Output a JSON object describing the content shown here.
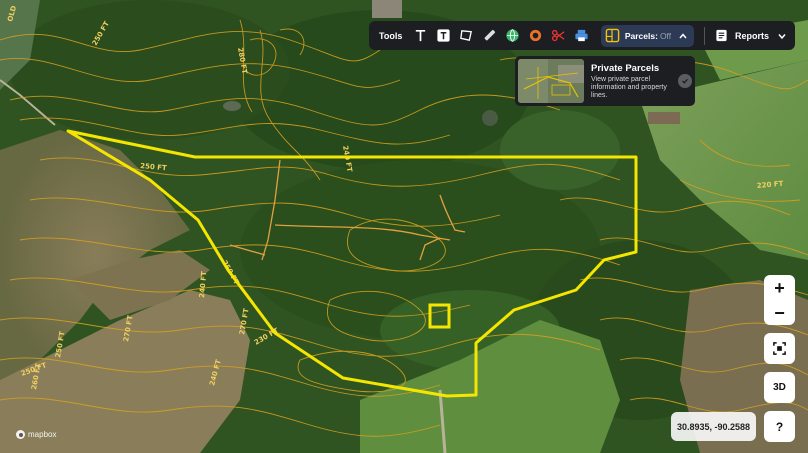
{
  "toolbar": {
    "tools_label": "Tools",
    "parcels_label": "Parcels:",
    "parcels_state": "Off",
    "reports_label": "Reports",
    "icons": [
      "text-icon",
      "text-box-icon",
      "polygon-icon",
      "ruler-icon",
      "globe-icon",
      "circle-target-icon",
      "scissors-icon",
      "printer-icon",
      "parcels-icon",
      "chevron-up-icon",
      "reports-icon",
      "chevron-down-icon"
    ]
  },
  "popup": {
    "title": "Private Parcels",
    "description": "View private parcel information and property lines."
  },
  "controls": {
    "zoom_in": "+",
    "zoom_out": "−",
    "three_d": "3D",
    "help": "?"
  },
  "coordinates": "30.8935, -90.2588",
  "attribution": "mapbox",
  "contour_labels": [
    "250 FT",
    "260 FT",
    "280 FT",
    "240 FT",
    "250 FT",
    "220 FT",
    "250 FT",
    "240 FT",
    "270 FT",
    "260 FT",
    "250 FT",
    "270 FT",
    "260 FT",
    "250 FT",
    "230 FT",
    "240 FT",
    "250 FT",
    "OLD"
  ],
  "colors": {
    "boundary": "#f4e600",
    "contour": "#d4a020",
    "toolbar_bg": "#1c1e22",
    "parcels_bg": "#2d3a55"
  }
}
